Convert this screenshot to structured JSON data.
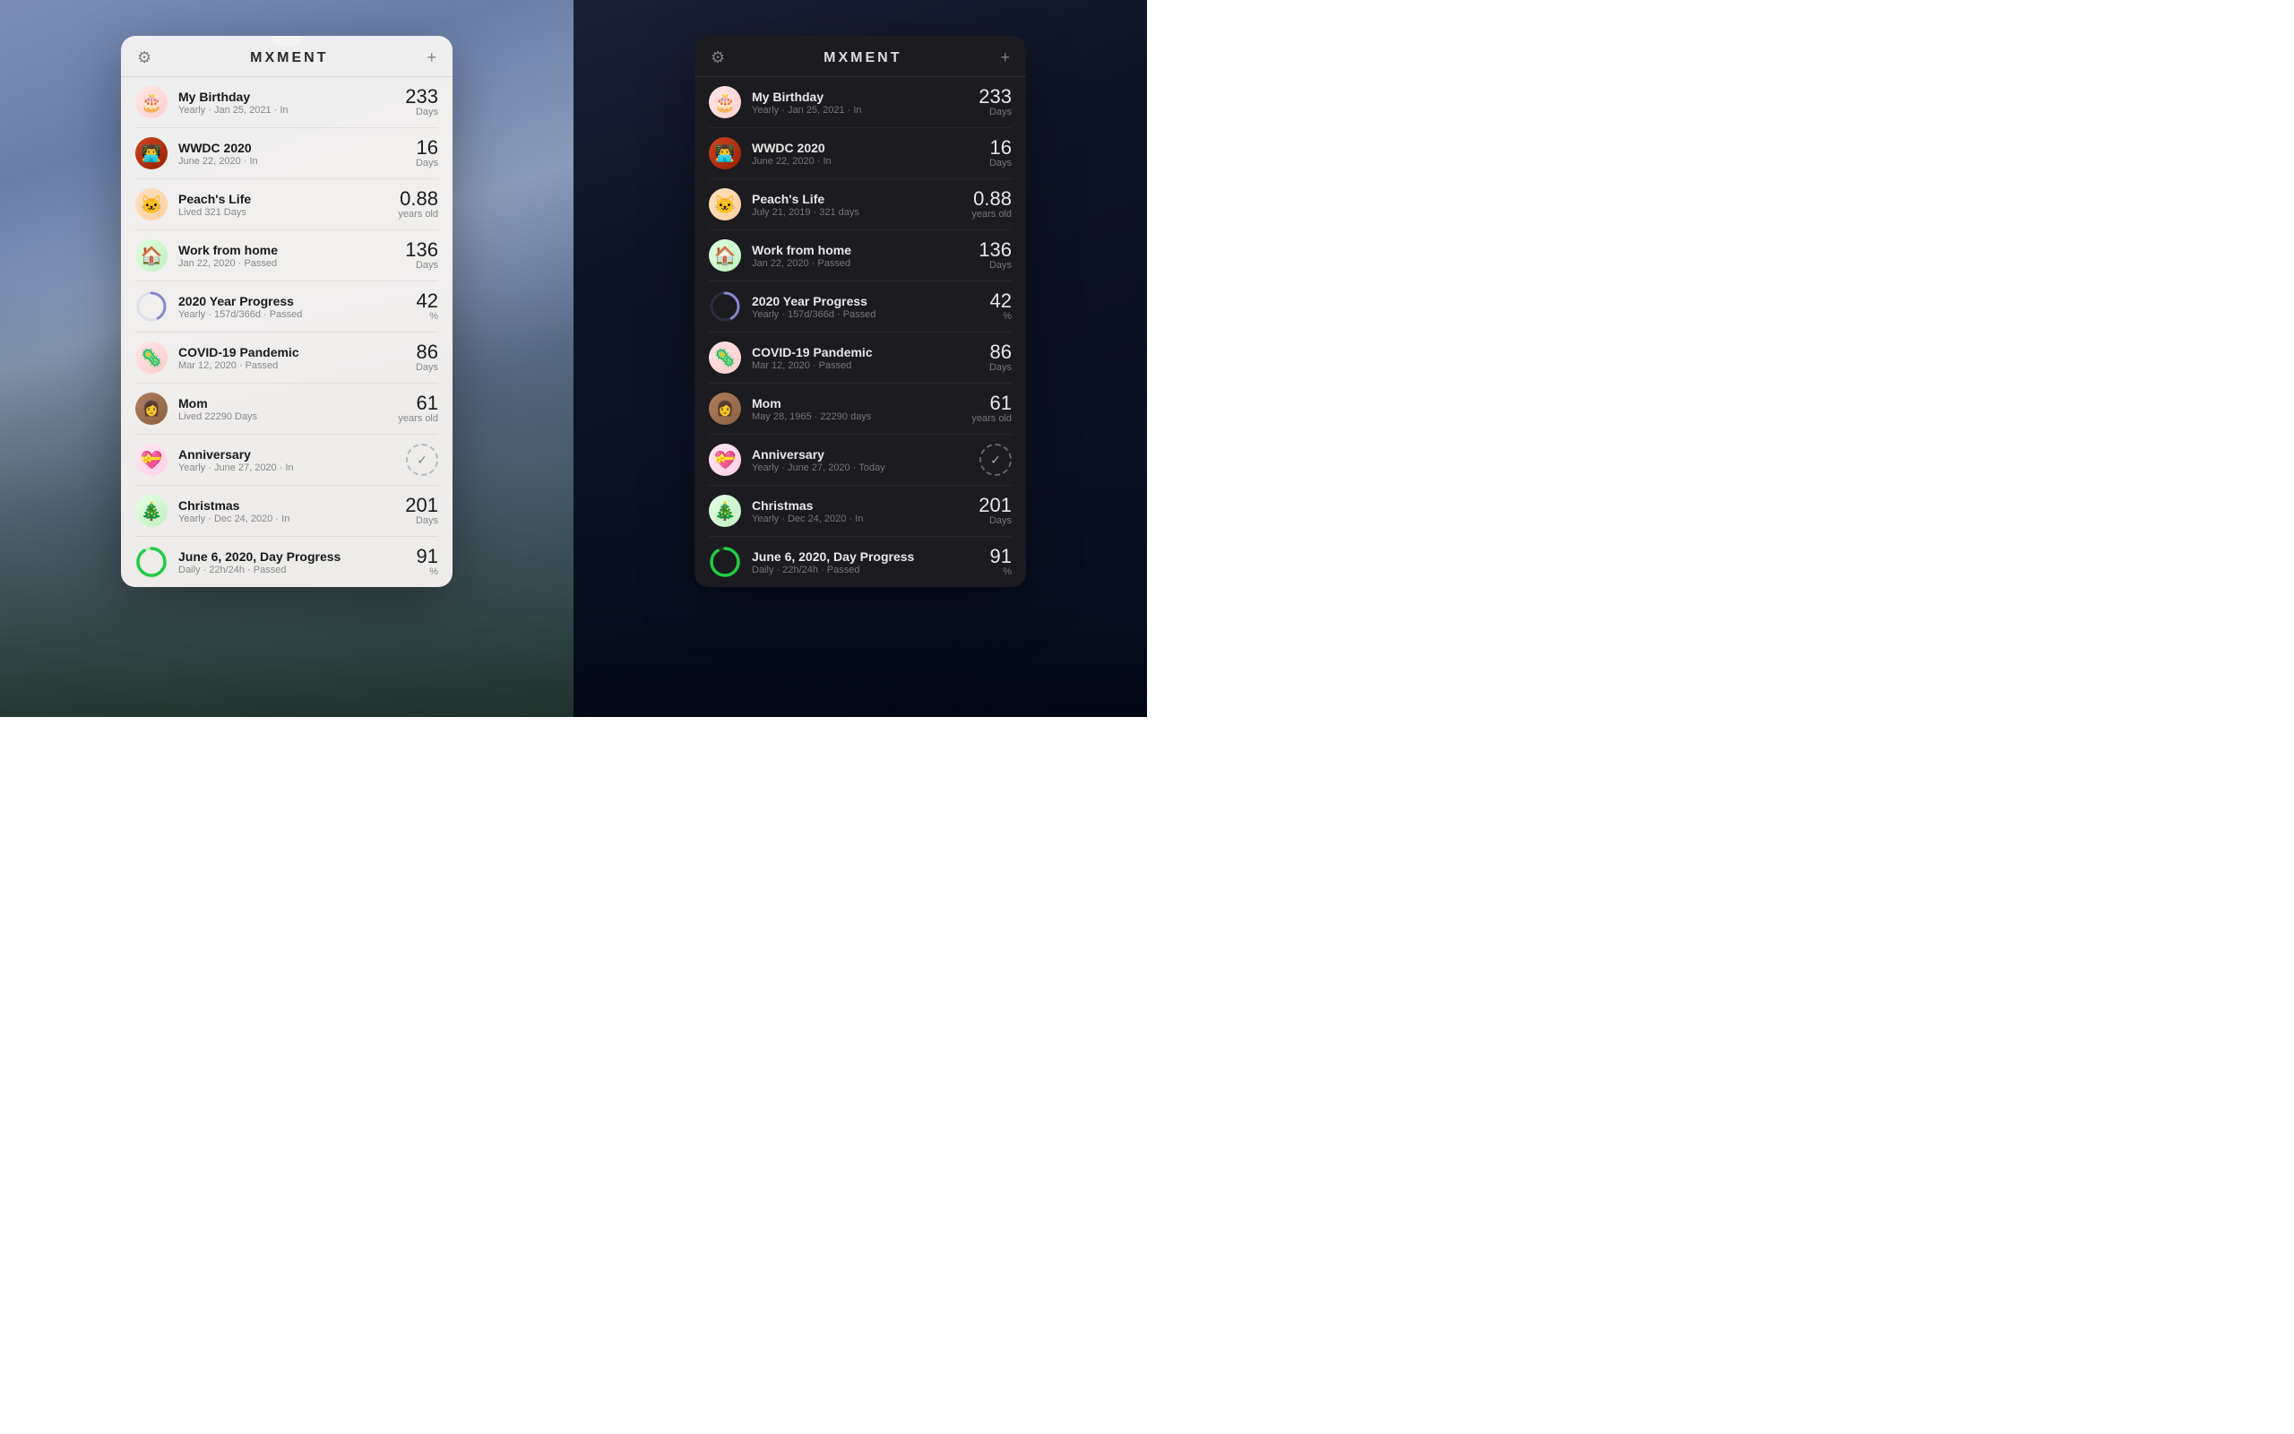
{
  "app": {
    "title": "MXMENT",
    "settings_icon": "⚙",
    "add_icon": "+"
  },
  "light_widget": {
    "events": [
      {
        "id": "birthday",
        "icon_emoji": "🎂",
        "icon_bg": "emoji-bg-birthday",
        "name": "My Birthday",
        "sub": "Yearly · Jan 25, 2021 · In",
        "number": "233",
        "unit": "Days"
      },
      {
        "id": "wwdc",
        "icon_type": "wwdc",
        "name": "WWDC 2020",
        "sub": "June 22, 2020 · In",
        "number": "16",
        "unit": "Days"
      },
      {
        "id": "peach",
        "icon_type": "peach",
        "name": "Peach's Life",
        "sub": "Lived 321 Days",
        "number": "0.88",
        "unit": "years old"
      },
      {
        "id": "work",
        "icon_emoji": "🏠",
        "icon_bg": "emoji-bg-work",
        "name": "Work from home",
        "sub": "Jan 22, 2020 · Passed",
        "number": "136",
        "unit": "Days"
      },
      {
        "id": "year-progress",
        "icon_type": "year-progress",
        "name": "2020 Year Progress",
        "sub": "Yearly · 157d/366d · Passed",
        "number": "42",
        "unit": "%"
      },
      {
        "id": "covid",
        "icon_emoji": "🦠",
        "icon_bg": "emoji-bg-covid",
        "name": "COVID-19 Pandemic",
        "sub": "Mar 12, 2020 · Passed",
        "number": "86",
        "unit": "Days"
      },
      {
        "id": "mom",
        "icon_type": "mom",
        "name": "Mom",
        "sub": "Lived 22290 Days",
        "number": "61",
        "unit": "years old"
      },
      {
        "id": "anniversary",
        "icon_emoji": "💝",
        "icon_bg": "emoji-bg-anniversary",
        "name": "Anniversary",
        "sub": "Yearly · June 27, 2020 · In",
        "icon_type": "anniversary",
        "number": "",
        "unit": ""
      },
      {
        "id": "christmas",
        "icon_emoji": "🎄",
        "icon_bg": "emoji-bg-christmas",
        "name": "Christmas",
        "sub": "Yearly · Dec 24, 2020 · In",
        "number": "201",
        "unit": "Days"
      },
      {
        "id": "day-progress",
        "icon_type": "day-progress",
        "name": "June 6, 2020, Day Progress",
        "sub": "Daily · 22h/24h · Passed",
        "number": "91",
        "unit": "%"
      }
    ]
  },
  "dark_widget": {
    "events": [
      {
        "id": "birthday",
        "icon_emoji": "🎂",
        "icon_bg": "emoji-bg-birthday",
        "name": "My Birthday",
        "sub": "Yearly · Jan 25, 2021 · In",
        "number": "233",
        "unit": "Days"
      },
      {
        "id": "wwdc",
        "icon_type": "wwdc",
        "name": "WWDC 2020",
        "sub": "June 22, 2020 · In",
        "number": "16",
        "unit": "Days"
      },
      {
        "id": "peach",
        "icon_type": "peach",
        "name": "Peach's Life",
        "sub": "July 21, 2019 · 321 days",
        "number": "0.88",
        "unit": "years old"
      },
      {
        "id": "work",
        "icon_emoji": "🏠",
        "icon_bg": "emoji-bg-work",
        "name": "Work from home",
        "sub": "Jan 22, 2020 · Passed",
        "number": "136",
        "unit": "Days"
      },
      {
        "id": "year-progress",
        "icon_type": "year-progress",
        "name": "2020 Year Progress",
        "sub": "Yearly · 157d/366d · Passed",
        "number": "42",
        "unit": "%"
      },
      {
        "id": "covid",
        "icon_emoji": "🦠",
        "icon_bg": "emoji-bg-covid",
        "name": "COVID-19 Pandemic",
        "sub": "Mar 12, 2020 · Passed",
        "number": "86",
        "unit": "Days"
      },
      {
        "id": "mom",
        "icon_type": "mom",
        "name": "Mom",
        "sub": "May 28, 1965 · 22290 days",
        "number": "61",
        "unit": "years old"
      },
      {
        "id": "anniversary",
        "icon_emoji": "💝",
        "icon_bg": "emoji-bg-anniversary",
        "name": "Anniversary",
        "sub": "Yearly · June 27, 2020 · Today",
        "icon_type": "anniversary",
        "number": "",
        "unit": ""
      },
      {
        "id": "christmas",
        "icon_emoji": "🎄",
        "icon_bg": "emoji-bg-christmas",
        "name": "Christmas",
        "sub": "Yearly · Dec 24, 2020 · In",
        "number": "201",
        "unit": "Days"
      },
      {
        "id": "day-progress",
        "icon_type": "day-progress",
        "name": "June 6, 2020, Day Progress",
        "sub": "Daily · 22h/24h · Passed",
        "number": "91",
        "unit": "%"
      }
    ]
  }
}
